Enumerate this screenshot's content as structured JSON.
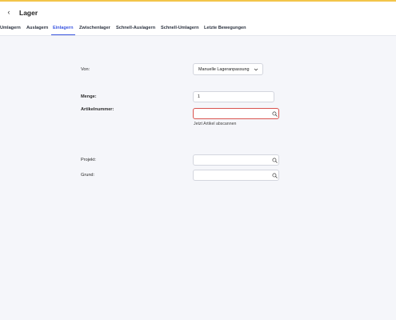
{
  "header": {
    "back_glyph": "‹",
    "title": "Lager"
  },
  "tabs": [
    {
      "label": "Umlagern"
    },
    {
      "label": "Auslagern"
    },
    {
      "label": "Einlagern",
      "active": true
    },
    {
      "label": "Zwischenlager"
    },
    {
      "label": "Schnell-Auslagern"
    },
    {
      "label": "Schnell-Umlagern"
    },
    {
      "label": "Letzte Bewegungen"
    }
  ],
  "form": {
    "von": {
      "label": "Von:",
      "value": "Manuelle Lageranpassung"
    },
    "menge": {
      "label": "Menge:",
      "value": "1"
    },
    "artikelnummer": {
      "label": "Artikelnummer:",
      "value": "",
      "hint": "Jetzt Artikel abscannen"
    },
    "projekt": {
      "label": "Projekt:",
      "value": ""
    },
    "grund": {
      "label": "Grund:",
      "value": ""
    }
  },
  "colors": {
    "accent": "#3a55e0",
    "error_border": "#d9534f",
    "top_stripe": "#f3c54a",
    "background": "#f5f6fa"
  },
  "icons": {
    "back": "chevron-left-icon",
    "dropdown": "chevron-down-icon",
    "search": "search-icon"
  }
}
